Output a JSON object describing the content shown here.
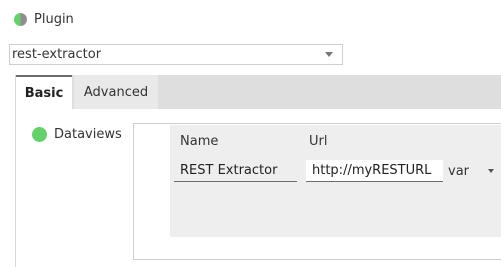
{
  "plugin": {
    "label": "Plugin",
    "icon": "plugin-status-dot"
  },
  "select": {
    "value": "rest-extractor"
  },
  "tabs": [
    {
      "label": "Basic",
      "active": true
    },
    {
      "label": "Advanced",
      "active": false
    }
  ],
  "dataviews": {
    "label": "Dataviews",
    "icon": "green-status-dot",
    "columns": [
      "Name",
      "Url"
    ],
    "rows": [
      {
        "name": "REST Extractor",
        "url": "http://myRESTURL",
        "type": "var"
      }
    ]
  },
  "colors": {
    "green": "#64d16a",
    "tabbar": "#dedede",
    "table_bg": "#eeeeee"
  }
}
